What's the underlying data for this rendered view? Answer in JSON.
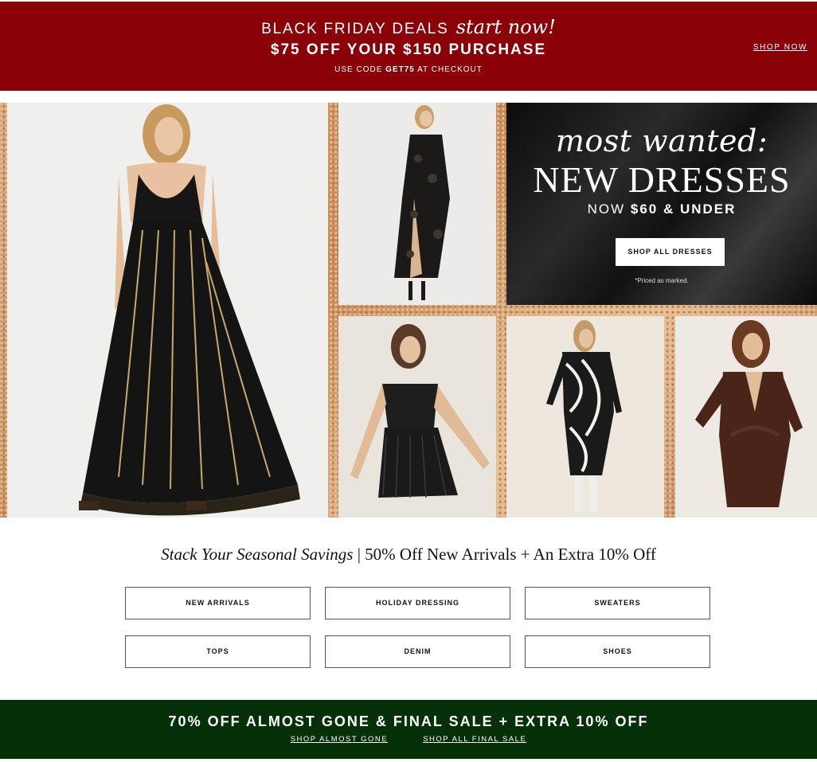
{
  "top_banner": {
    "line1_text": "BLACK FRIDAY DEALS",
    "line1_script": "start now!",
    "line2": "$75 OFF YOUR $150 PURCHASE",
    "line3_prefix": "USE CODE",
    "line3_code": "GET75",
    "line3_suffix": "AT CHECKOUT",
    "shop_now": "SHOP NOW",
    "bg_color": "#8a0208"
  },
  "hero": {
    "promo": {
      "script": "most wanted:",
      "headline": "NEW DRESSES",
      "price_prefix": "NOW",
      "price_value": "$60 & UNDER",
      "button": "SHOP ALL DRESSES",
      "note": "*Priced as marked."
    },
    "tiles": [
      {
        "icon": "embellished-maxi-dress-photo"
      },
      {
        "icon": "velvet-burnout-slip-dress-photo"
      },
      {
        "icon": "fringe-corset-minidress-photo"
      },
      {
        "icon": "swirl-print-midi-dress-photo"
      },
      {
        "icon": "brown-velvet-wrap-dress-photo"
      }
    ]
  },
  "savings": {
    "title_italic": "Stack Your Seasonal Savings",
    "title_separator": "|",
    "title_rest": "50% Off New Arrivals + An Extra 10% Off",
    "categories": [
      "NEW ARRIVALS",
      "HOLIDAY DRESSING",
      "SWEATERS",
      "TOPS",
      "DENIM",
      "SHOES"
    ]
  },
  "bottom_banner": {
    "headline": "70% OFF ALMOST GONE & FINAL SALE + EXTRA 10% OFF",
    "link1": "SHOP ALMOST GONE",
    "link2": "SHOP ALL FINAL SALE",
    "bg_color": "#063007"
  }
}
